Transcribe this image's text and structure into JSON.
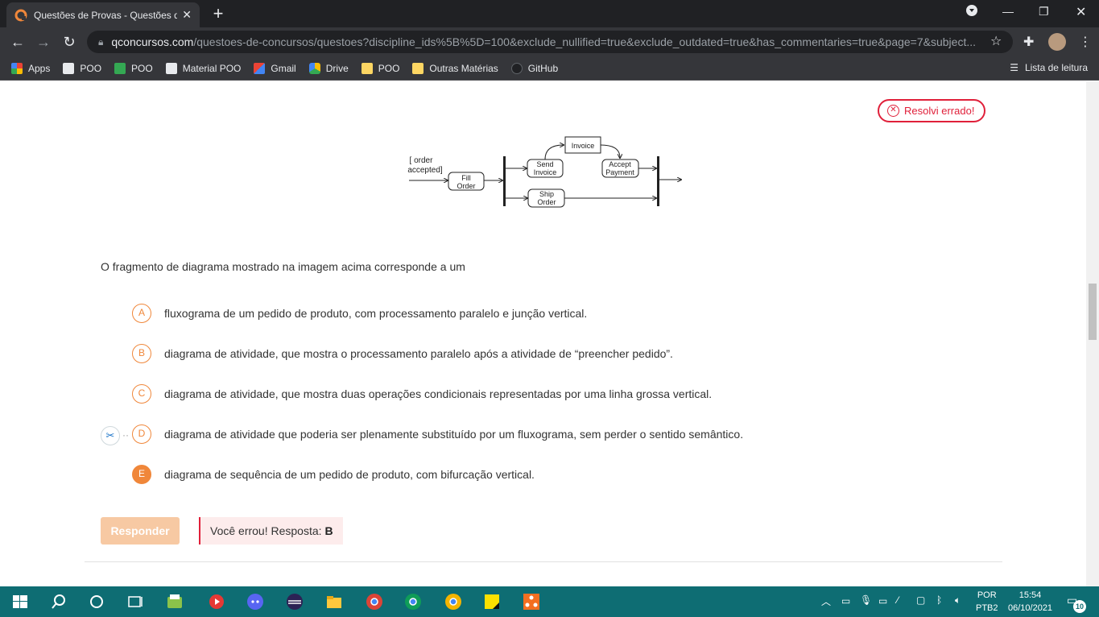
{
  "browser": {
    "tab_title": "Questões de Provas - Questões d",
    "tab_close": "✕",
    "new_tab": "+",
    "url_host": "qconcursos.com",
    "url_path": "/questoes-de-concursos/questoes?discipline_ids%5B%5D=100&exclude_nullified=true&exclude_outdated=true&has_commentaries=true&page=7&subject...",
    "bookmarks": [
      {
        "label": "Apps",
        "color": "#ea4335"
      },
      {
        "label": "POO",
        "color": "#9aa0a6"
      },
      {
        "label": "POO",
        "color": "#34a853"
      },
      {
        "label": "Material POO",
        "color": "#9aa0a6"
      },
      {
        "label": "Gmail",
        "color": "#ea4335"
      },
      {
        "label": "Drive",
        "color": "#fbbc04"
      },
      {
        "label": "POO",
        "color": "#fdd663"
      },
      {
        "label": "Outras Matérias",
        "color": "#fdd663"
      },
      {
        "label": "GitHub",
        "color": "#202124"
      }
    ],
    "reading_list": "Lista de leitura"
  },
  "question": {
    "status_badge": "Resolvi errado!",
    "diagram": {
      "guard": "[ order",
      "guard2": "accepted]",
      "fill_order_1": "Fill",
      "fill_order_2": "Order",
      "invoice": "Invoice",
      "send_invoice_1": "Send",
      "send_invoice_2": "Invoice",
      "accept_payment_1": "Accept",
      "accept_payment_2": "Payment",
      "ship_order_1": "Ship",
      "ship_order_2": "Order"
    },
    "text": "O fragmento de diagrama mostrado na imagem acima corresponde a um",
    "options": [
      {
        "letter": "A",
        "text": "fluxograma de um pedido de produto, com processamento paralelo e junção vertical."
      },
      {
        "letter": "B",
        "text": "diagrama de atividade, que mostra o processamento paralelo após a atividade de “preencher pedido”."
      },
      {
        "letter": "C",
        "text": "diagrama de atividade, que mostra duas operações condicionais representadas por uma linha grossa vertical."
      },
      {
        "letter": "D",
        "text": "diagrama de atividade que poderia ser plenamente substituído por um fluxograma, sem perder o sentido semântico."
      },
      {
        "letter": "E",
        "text": "diagrama de sequência de um pedido de produto, com bifurcação vertical."
      }
    ],
    "selected": "E",
    "responder_label": "Responder",
    "result_text": "Você errou!  Resposta:",
    "result_answer": "B"
  },
  "taskbar": {
    "lang_1": "POR",
    "lang_2": "PTB2",
    "time": "15:54",
    "date": "06/10/2021",
    "notification_count": "10"
  },
  "colors": {
    "accent": "#f0873a",
    "error": "#e0203a",
    "taskbar": "#0e6d73"
  }
}
